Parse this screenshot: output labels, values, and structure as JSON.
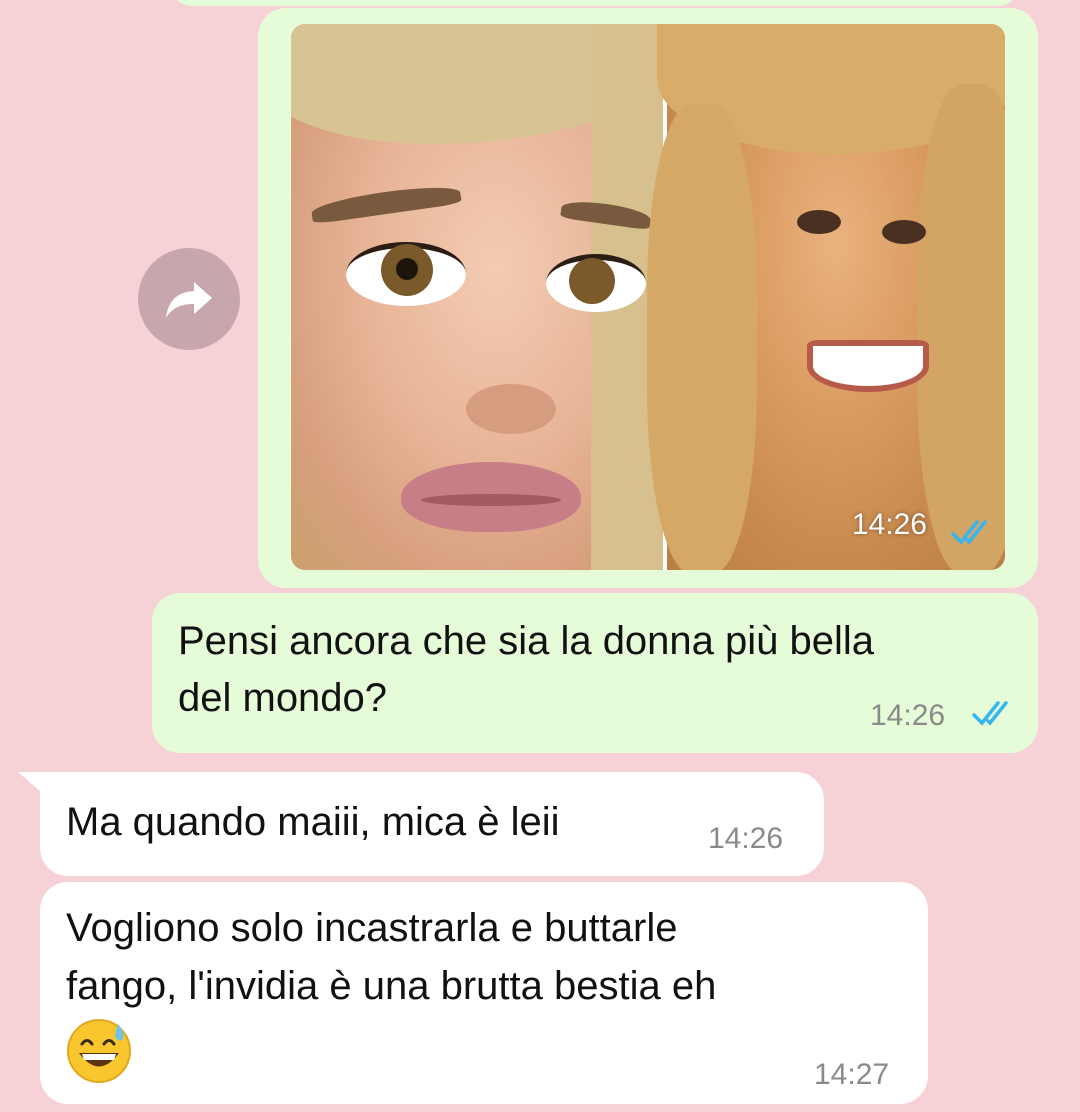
{
  "forward": {
    "icon": "forward-arrow-icon"
  },
  "image_message": {
    "time": "14:26",
    "status_icon": "double-check-read-icon",
    "status_color": "#34b7f1"
  },
  "messages": [
    {
      "direction": "outgoing",
      "text_line1": "Pensi ancora che sia la donna più bella",
      "text_line2": "del mondo?",
      "time": "14:26",
      "status_icon": "double-check-read-icon"
    },
    {
      "direction": "incoming",
      "text": "Ma quando maiii, mica è leii",
      "time": "14:26"
    },
    {
      "direction": "incoming",
      "text_line1": "Vogliono solo incastrarla e buttarle",
      "text_line2": "fango, l'invidia è una brutta bestia eh",
      "emoji": "grinning-face-with-sweat-emoji",
      "time": "14:27"
    }
  ],
  "colors": {
    "background": "#f6d2d7",
    "outgoing_bubble": "#e6fbd8",
    "incoming_bubble": "#ffffff",
    "read_ticks": "#34b7f1"
  }
}
